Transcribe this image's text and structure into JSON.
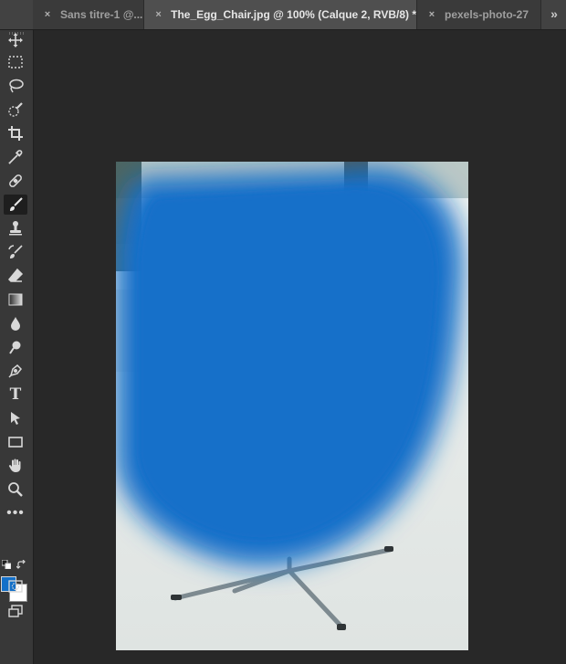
{
  "tabs": [
    {
      "label": "Sans titre-1 @...",
      "active": false
    },
    {
      "label": "The_Egg_Chair.jpg @ 100% (Calque 2, RVB/8) *",
      "active": true
    },
    {
      "label": "pexels-photo-27",
      "active": false
    }
  ],
  "tab_close_glyph": "×",
  "tab_overflow_glyph": "»",
  "toolbar": {
    "tools": [
      {
        "name": "move-icon",
        "selected": false
      },
      {
        "name": "rectangular-marquee-icon",
        "selected": false
      },
      {
        "name": "lasso-icon",
        "selected": false
      },
      {
        "name": "quick-selection-icon",
        "selected": false
      },
      {
        "name": "crop-icon",
        "selected": false
      },
      {
        "name": "eyedropper-icon",
        "selected": false
      },
      {
        "name": "healing-brush-icon",
        "selected": false
      },
      {
        "name": "brush-icon",
        "selected": true
      },
      {
        "name": "clone-stamp-icon",
        "selected": false
      },
      {
        "name": "history-brush-icon",
        "selected": false
      },
      {
        "name": "eraser-icon",
        "selected": false
      },
      {
        "name": "gradient-icon",
        "selected": false
      },
      {
        "name": "blur-icon",
        "selected": false
      },
      {
        "name": "dodge-icon",
        "selected": false
      },
      {
        "name": "pen-icon",
        "selected": false
      },
      {
        "name": "type-icon",
        "selected": false
      },
      {
        "name": "path-selection-icon",
        "selected": false
      },
      {
        "name": "rectangle-icon",
        "selected": false
      },
      {
        "name": "hand-icon",
        "selected": false
      },
      {
        "name": "zoom-icon",
        "selected": false
      },
      {
        "name": "more-tools-icon",
        "selected": false
      },
      {
        "name": "quick-mask-icon",
        "selected": false
      },
      {
        "name": "screen-mode-icon",
        "selected": false
      }
    ],
    "type_tool_glyph": "T",
    "more_tools_glyph": "•••"
  },
  "colors": {
    "foreground": "#1470c8",
    "background": "#ffffff",
    "brush_paint": "#1570c9"
  }
}
